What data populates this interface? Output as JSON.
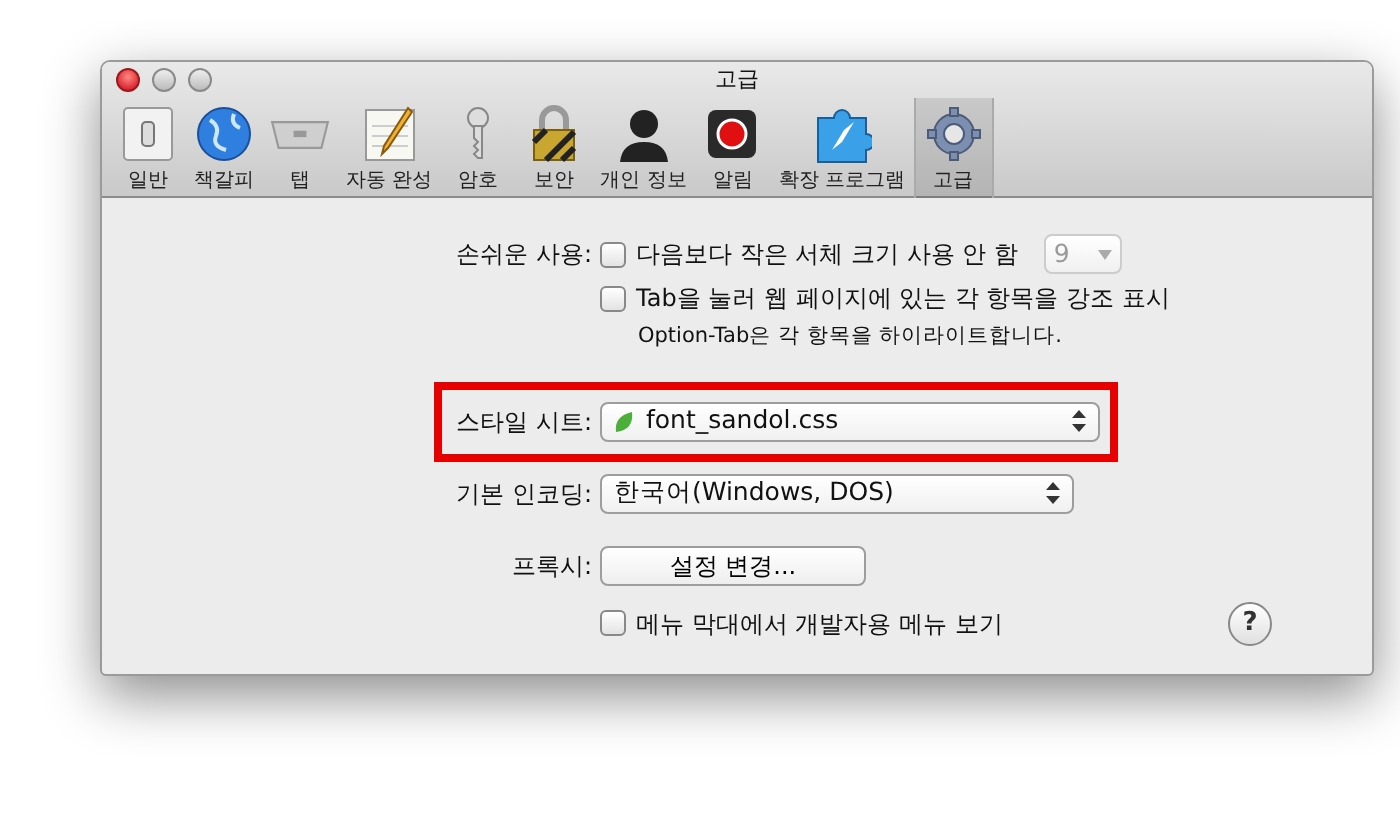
{
  "window": {
    "title": "고급"
  },
  "toolbar": [
    {
      "label": "일반",
      "kind": "switch",
      "selected": false
    },
    {
      "label": "책갈피",
      "kind": "globe",
      "selected": false
    },
    {
      "label": "탭",
      "kind": "tab",
      "selected": false
    },
    {
      "label": "자동 완성",
      "kind": "notepad",
      "selected": false
    },
    {
      "label": "암호",
      "kind": "key",
      "selected": false
    },
    {
      "label": "보안",
      "kind": "lock",
      "selected": false
    },
    {
      "label": "개인 정보",
      "kind": "person",
      "selected": false
    },
    {
      "label": "알림",
      "kind": "record",
      "selected": false
    },
    {
      "label": "확장 프로그램",
      "kind": "puzzle",
      "selected": false
    },
    {
      "label": "고급",
      "kind": "gear",
      "selected": true
    }
  ],
  "accessibility": {
    "label": "손쉬운 사용:",
    "options": [
      {
        "label": "다음보다 작은 서체 크기 사용 안 함",
        "checked": false,
        "font_size": {
          "value": "9",
          "disabled": true
        }
      },
      {
        "label": "Tab을 눌러 웹 페이지에 있는 각 항목을 강조 표시",
        "checked": false,
        "note": "Option-Tab은 각 항목을 하이라이트합니다."
      }
    ]
  },
  "style_sheet": {
    "label": "스타일 시트:",
    "value": "font_sandol.css",
    "highlighted": true
  },
  "default_encoding": {
    "label": "기본 인코딩:",
    "value": "한국어(Windows, DOS)"
  },
  "proxies": {
    "label": "프록시:",
    "button": "설정 변경..."
  },
  "develop_menu": {
    "label": "메뉴 막대에서 개발자용 메뉴 보기",
    "checked": false
  },
  "help_button": "?"
}
